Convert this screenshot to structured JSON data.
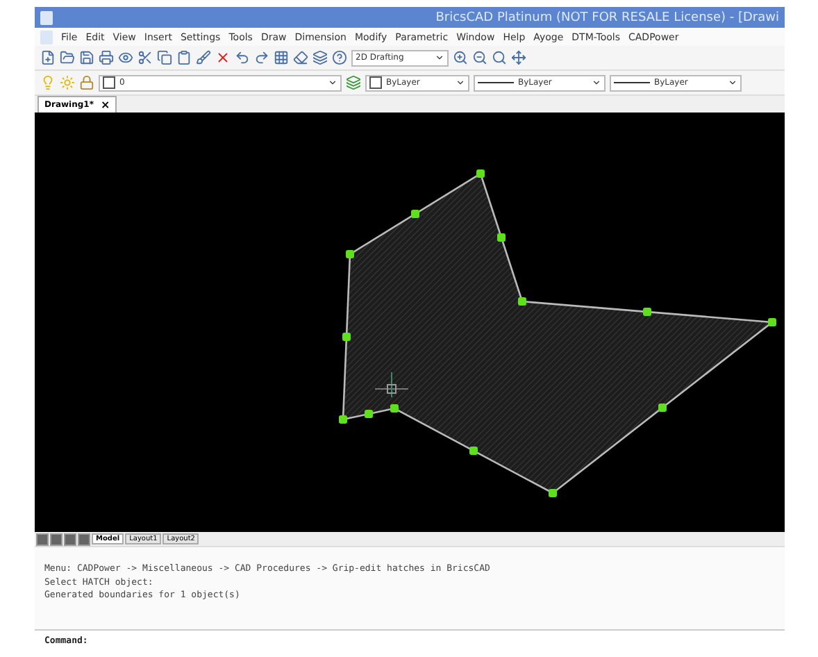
{
  "window": {
    "title": "BricsCAD Platinum (NOT FOR RESALE License) - [Drawi"
  },
  "menu": [
    "File",
    "Edit",
    "View",
    "Insert",
    "Settings",
    "Tools",
    "Draw",
    "Dimension",
    "Modify",
    "Parametric",
    "Window",
    "Help",
    "Ayoge",
    "DTM-Tools",
    "CADPower"
  ],
  "toolbar": {
    "workspace": "2D Drafting"
  },
  "properties_bar": {
    "layer": "0",
    "colour_setting": "ByLayer",
    "linetype": "ByLayer",
    "lineweight": "ByLayer"
  },
  "document_tabs": [
    {
      "label": "Drawing1*",
      "close": "×",
      "selected": true
    }
  ],
  "layout_tabs": [
    {
      "label": "Model",
      "selected": true
    },
    {
      "label": "Layout1",
      "selected": false
    },
    {
      "label": "Layout2",
      "selected": false
    }
  ],
  "command_history": [
    "Menu: CADPower -> Miscellaneous -> CAD Procedures -> Grip-edit hatches in BricsCAD",
    "Select HATCH object:",
    "Generated boundaries for 1 object(s)"
  ],
  "command_line": {
    "prompt": "Command:"
  }
}
